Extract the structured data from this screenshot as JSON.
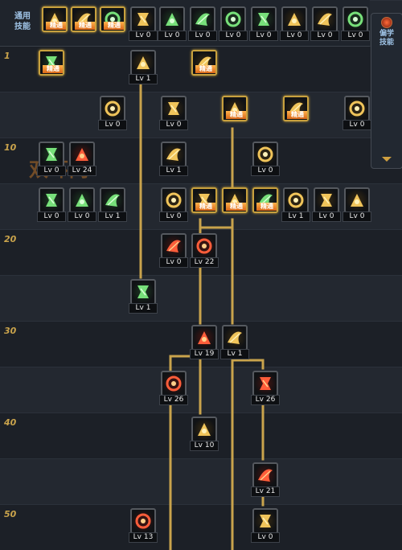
{
  "rows": [
    {
      "label": ""
    },
    {
      "label": "1"
    },
    {
      "label": ""
    },
    {
      "label": "10"
    },
    {
      "label": ""
    },
    {
      "label": "20"
    },
    {
      "label": ""
    },
    {
      "label": "30"
    },
    {
      "label": ""
    },
    {
      "label": "40"
    },
    {
      "label": ""
    },
    {
      "label": "50"
    }
  ],
  "common_label": "通用\n技能",
  "side_label": "偏学\n技能",
  "watermark": "双环网",
  "mastered_text": "精通",
  "colors": {
    "gold": "#c8a13e",
    "line": "#c9a34c",
    "level_number": "#c9a34c",
    "label_blue": "#9fc3e6"
  },
  "top_skills": [
    {
      "name": "sit-icon",
      "status": "mastered",
      "theme": "gold",
      "lv": ""
    },
    {
      "name": "helmet-icon",
      "status": "mastered",
      "theme": "gold",
      "lv": ""
    },
    {
      "name": "runner-icon",
      "status": "mastered",
      "theme": "green",
      "lv": ""
    },
    {
      "name": "wings-icon",
      "status": "level",
      "theme": "gold",
      "lv": "Lv 0"
    },
    {
      "name": "crosshair-icon",
      "status": "level",
      "theme": "green",
      "lv": "Lv 0"
    },
    {
      "name": "crosshair-icon",
      "status": "level",
      "theme": "green",
      "lv": "Lv 0"
    },
    {
      "name": "fighter-icon",
      "status": "level",
      "theme": "green",
      "lv": "Lv 0"
    },
    {
      "name": "fighter-icon",
      "status": "level",
      "theme": "green",
      "lv": "Lv 0"
    },
    {
      "name": "target-ring-icon",
      "status": "level",
      "theme": "gold",
      "lv": "Lv 0"
    },
    {
      "name": "muscle-icon",
      "status": "level",
      "theme": "gold",
      "lv": "Lv 0"
    },
    {
      "name": "kick-icon",
      "status": "level",
      "theme": "green",
      "lv": "Lv 0"
    }
  ],
  "side_skills": [
    {
      "name": "impact-icon",
      "lv": "Lv 0"
    },
    {
      "name": "scroll-icon",
      "lv": "Lv 0"
    },
    {
      "name": "chevron-icon",
      "lv": "Lv 0"
    }
  ],
  "tree_skills": [
    {
      "name": "helmet-icon",
      "theme": "green",
      "status": "mastered",
      "lv": ""
    },
    {
      "name": "claw-icon",
      "theme": "gold",
      "status": "level",
      "lv": "Lv 1"
    },
    {
      "name": "slash-icon",
      "theme": "gold",
      "status": "mastered",
      "lv": ""
    },
    {
      "name": "wings-icon",
      "theme": "gold",
      "status": "level",
      "lv": "Lv 0"
    },
    {
      "name": "arrow-icon",
      "theme": "gold",
      "status": "level",
      "lv": "Lv 0"
    },
    {
      "name": "swirl-icon",
      "theme": "gold",
      "status": "mastered",
      "lv": ""
    },
    {
      "name": "shield-icon",
      "theme": "gold",
      "status": "mastered",
      "lv": ""
    },
    {
      "name": "claws-icon",
      "theme": "gold",
      "status": "level",
      "lv": "Lv 0"
    },
    {
      "name": "blade-icon",
      "theme": "green",
      "status": "level",
      "lv": "Lv 0"
    },
    {
      "name": "blade-icon",
      "theme": "red",
      "status": "level",
      "lv": "Lv 24"
    },
    {
      "name": "fire-icon",
      "theme": "gold",
      "status": "level",
      "lv": "Lv 1"
    },
    {
      "name": "spin-icon",
      "theme": "gold",
      "status": "level",
      "lv": "Lv 0"
    },
    {
      "name": "sword-icon",
      "theme": "green",
      "status": "level",
      "lv": "Lv 0"
    },
    {
      "name": "burst-icon",
      "theme": "green",
      "status": "level",
      "lv": "Lv 0"
    },
    {
      "name": "dagger-icon",
      "theme": "green",
      "status": "level",
      "lv": "Lv 1"
    },
    {
      "name": "crescent-icon",
      "theme": "gold",
      "status": "level",
      "lv": "Lv 0"
    },
    {
      "name": "guard-icon",
      "theme": "gold",
      "status": "mastered",
      "lv": ""
    },
    {
      "name": "tiger-icon",
      "theme": "gold",
      "status": "mastered",
      "lv": ""
    },
    {
      "name": "moon-icon",
      "theme": "green",
      "status": "mastered",
      "lv": ""
    },
    {
      "name": "wind-icon",
      "theme": "gold",
      "status": "level",
      "lv": "Lv 1"
    },
    {
      "name": "cross-icon",
      "theme": "gold",
      "status": "level",
      "lv": "Lv 0"
    },
    {
      "name": "flame-icon",
      "theme": "gold",
      "status": "level",
      "lv": "Lv 0"
    },
    {
      "name": "orb-icon",
      "theme": "red",
      "status": "level",
      "lv": "Lv 0"
    },
    {
      "name": "warrior-icon",
      "theme": "red",
      "status": "level",
      "lv": "Lv 22"
    },
    {
      "name": "whirl-icon",
      "theme": "green",
      "status": "level",
      "lv": "Lv 1"
    },
    {
      "name": "dash-icon",
      "theme": "red",
      "status": "level",
      "lv": "Lv 19"
    },
    {
      "name": "beast-icon",
      "theme": "gold",
      "status": "level",
      "lv": "Lv 1"
    },
    {
      "name": "totem-icon",
      "theme": "red",
      "status": "level",
      "lv": "Lv 26"
    },
    {
      "name": "phoenix-icon",
      "theme": "red",
      "status": "level",
      "lv": "Lv 26"
    },
    {
      "name": "head-icon",
      "theme": "gold",
      "status": "level",
      "lv": "Lv 10"
    },
    {
      "name": "flare-icon",
      "theme": "red",
      "status": "level",
      "lv": "Lv 21"
    },
    {
      "name": "explosion-icon",
      "theme": "red",
      "status": "level",
      "lv": "Lv 13"
    },
    {
      "name": "leap-icon",
      "theme": "gold",
      "status": "level",
      "lv": "Lv 0"
    }
  ]
}
